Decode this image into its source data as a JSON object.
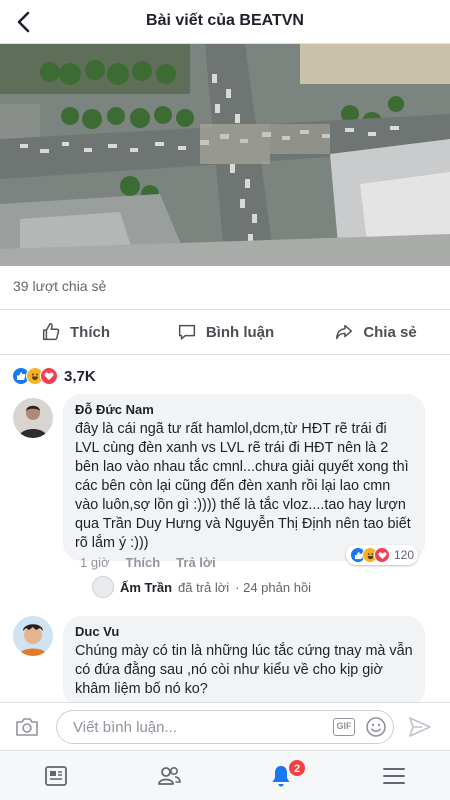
{
  "header": {
    "title": "Bài viết của BEATVN"
  },
  "post": {
    "shares_text": "39 lượt chia sẻ",
    "actions": {
      "like": "Thích",
      "comment": "Bình luận",
      "share": "Chia sẻ"
    },
    "reaction_count": "3,7K"
  },
  "comments": [
    {
      "author": "Đỗ Đức Nam",
      "text": "đây là cái ngã tư rất hamlol,dcm,từ HĐT rẽ trái đi LVL cùng đèn xanh vs LVL rẽ trái đi HĐT nên là 2 bên lao vào nhau tắc cmnl...chưa giải quyết xong thì các bên còn lại cũng đến đèn xanh rồi lại lao cmn vào luôn,sợ lồn gì :)))) thế là tắc vloz....tao hay lượn qua Trần Duy Hưng và Nguyễn Thị Định nên tao biết rõ lắm ý :)))",
      "time": "1 giờ",
      "like_label": "Thích",
      "reply_label": "Trả lời",
      "reaction_count": "120",
      "reply_preview": {
        "author": "Ấm Trần",
        "action": "đã trả lời",
        "count": "· 24 phản hồi"
      }
    },
    {
      "author": "Duc Vu",
      "text": "Chúng mày có tin là những lúc tắc cứng tnay mà vẫn có đứa đằng sau ,nó còi như kiểu về cho kịp giờ khâm liệm bố nó ko?"
    }
  ],
  "composer": {
    "placeholder": "Viết bình luận...",
    "gif_label": "GIF"
  },
  "tabbar": {
    "notification_badge": "2"
  },
  "colors": {
    "accent": "#1877f2",
    "badge": "#fa3e3e",
    "love": "#f33e58",
    "haha": "#f7b125"
  }
}
